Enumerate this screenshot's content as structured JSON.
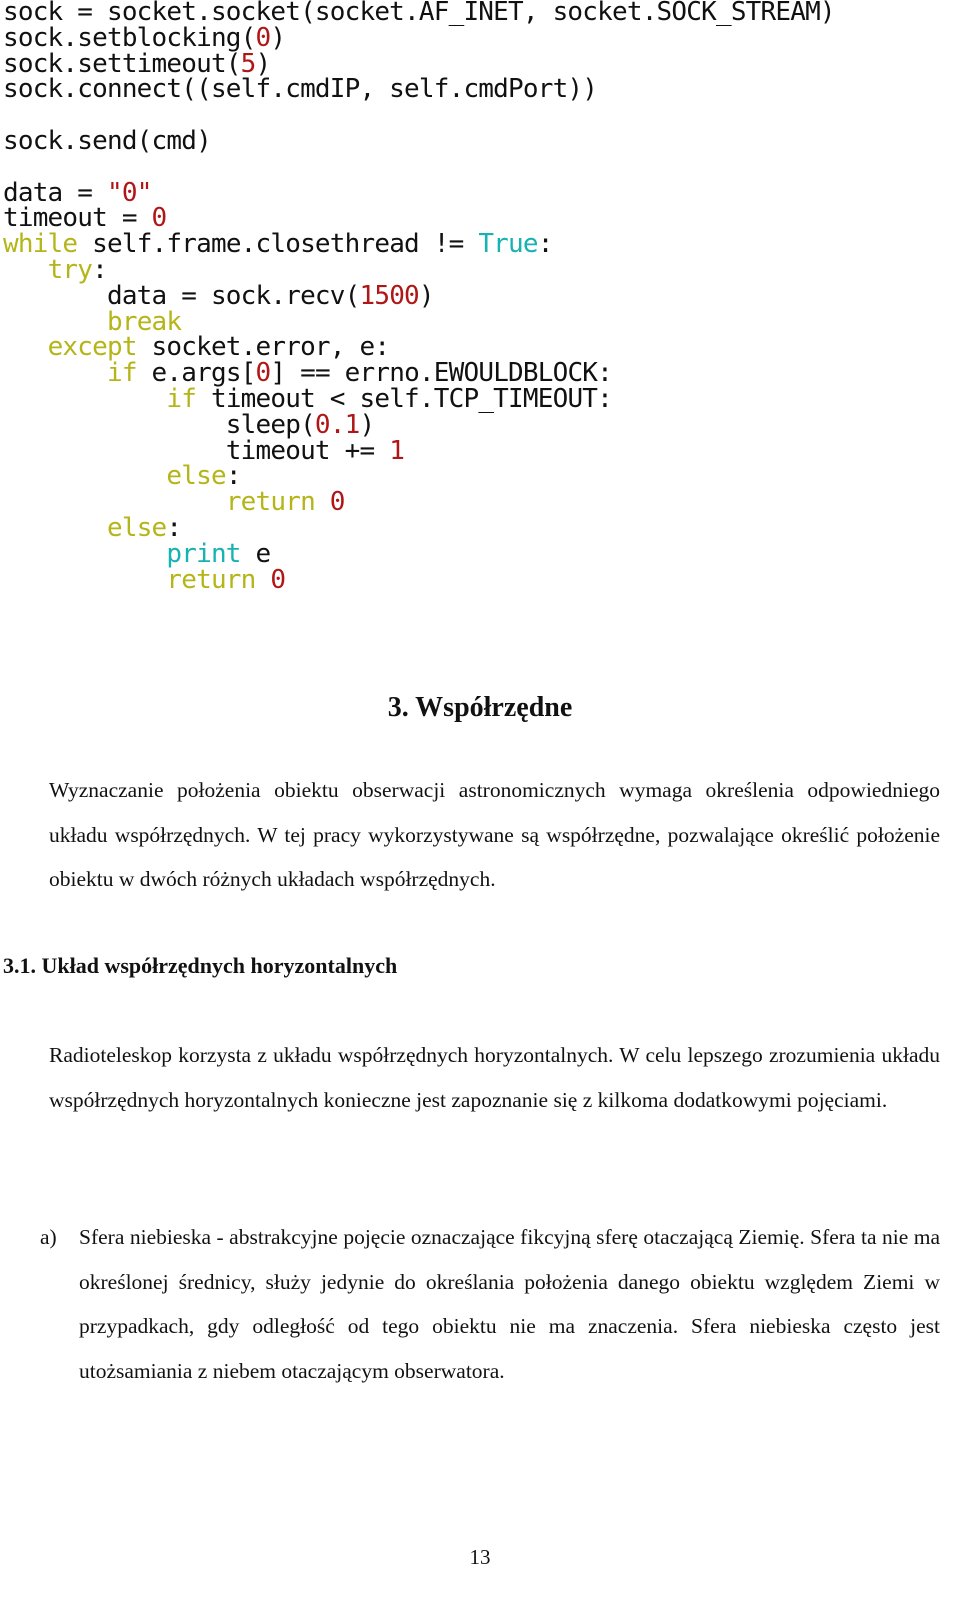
{
  "code": {
    "lines": [
      [
        {
          "t": "sock = socket.socket(socket.AF_INET, socket.SOCK_STREAM)",
          "c": ""
        }
      ],
      [
        {
          "t": "sock.setblocking(",
          "c": ""
        },
        {
          "t": "0",
          "c": "num"
        },
        {
          "t": ")",
          "c": ""
        }
      ],
      [
        {
          "t": "sock.settimeout(",
          "c": ""
        },
        {
          "t": "5",
          "c": "num"
        },
        {
          "t": ")",
          "c": ""
        }
      ],
      [
        {
          "t": "sock.connect((self.cmdIP, self.cmdPort))",
          "c": ""
        }
      ],
      null,
      [
        {
          "t": "sock.send(cmd)",
          "c": ""
        }
      ],
      null,
      [
        {
          "t": "data = ",
          "c": ""
        },
        {
          "t": "\"0\"",
          "c": "num"
        }
      ],
      [
        {
          "t": "timeout = ",
          "c": ""
        },
        {
          "t": "0",
          "c": "num"
        }
      ],
      [
        {
          "t": "while",
          "c": "kw"
        },
        {
          "t": " self.frame.closethread != ",
          "c": ""
        },
        {
          "t": "True",
          "c": "bi"
        },
        {
          "t": ":",
          "c": ""
        }
      ],
      [
        {
          "t": "   ",
          "c": ""
        },
        {
          "t": "try",
          "c": "kw"
        },
        {
          "t": ":",
          "c": ""
        }
      ],
      [
        {
          "t": "       data = sock.recv(",
          "c": ""
        },
        {
          "t": "1500",
          "c": "num"
        },
        {
          "t": ")",
          "c": ""
        }
      ],
      [
        {
          "t": "       ",
          "c": ""
        },
        {
          "t": "break",
          "c": "kw"
        }
      ],
      [
        {
          "t": "   ",
          "c": ""
        },
        {
          "t": "except",
          "c": "kw"
        },
        {
          "t": " socket.error, e:",
          "c": ""
        }
      ],
      [
        {
          "t": "       ",
          "c": ""
        },
        {
          "t": "if",
          "c": "kw"
        },
        {
          "t": " e.args[",
          "c": ""
        },
        {
          "t": "0",
          "c": "num"
        },
        {
          "t": "] == errno.EWOULDBLOCK:",
          "c": ""
        }
      ],
      [
        {
          "t": "           ",
          "c": ""
        },
        {
          "t": "if",
          "c": "kw"
        },
        {
          "t": " timeout < self.TCP_TIMEOUT:",
          "c": ""
        }
      ],
      [
        {
          "t": "               sleep(",
          "c": ""
        },
        {
          "t": "0.1",
          "c": "num"
        },
        {
          "t": ")",
          "c": ""
        }
      ],
      [
        {
          "t": "               timeout += ",
          "c": ""
        },
        {
          "t": "1",
          "c": "num"
        }
      ],
      [
        {
          "t": "           ",
          "c": ""
        },
        {
          "t": "else",
          "c": "kw"
        },
        {
          "t": ":",
          "c": ""
        }
      ],
      [
        {
          "t": "               ",
          "c": ""
        },
        {
          "t": "return",
          "c": "kw"
        },
        {
          "t": " ",
          "c": ""
        },
        {
          "t": "0",
          "c": "num"
        }
      ],
      [
        {
          "t": "       ",
          "c": ""
        },
        {
          "t": "else",
          "c": "kw"
        },
        {
          "t": ":",
          "c": ""
        }
      ],
      [
        {
          "t": "           ",
          "c": ""
        },
        {
          "t": "print",
          "c": "bi"
        },
        {
          "t": " e",
          "c": ""
        }
      ],
      [
        {
          "t": "           ",
          "c": ""
        },
        {
          "t": "return",
          "c": "kw"
        },
        {
          "t": " ",
          "c": ""
        },
        {
          "t": "0",
          "c": "num"
        }
      ]
    ]
  },
  "section": {
    "heading": "3. Współrzędne",
    "intro": "Wyznaczanie położenia obiektu obserwacji astronomicznych wymaga określenia odpowiedniego układu współrzędnych. W tej pracy wykorzystywane są współrzędne, pozwalające określić położenie obiektu w dwóch różnych układach współrzędnych."
  },
  "subsection": {
    "heading": "3.1.  Układ współrzędnych horyzontalnych",
    "paragraph": "Radioteleskop korzysta z układu współrzędnych horyzontalnych. W celu lepszego zrozumienia układu współrzędnych horyzontalnych konieczne jest zapoznanie się z kilkoma dodatkowymi pojęciami."
  },
  "list": [
    {
      "marker": "a)",
      "text": "Sfera niebieska - abstrakcyjne pojęcie oznaczające fikcyjną sferę otaczającą Ziemię. Sfera ta nie ma określonej średnicy, służy jedynie do określania położenia danego obiektu względem Ziemi w przypadkach, gdy odległość od tego obiektu nie ma znaczenia. Sfera niebieska często jest utożsamiania z niebem otaczającym obserwatora."
    }
  ],
  "page_number": "13"
}
